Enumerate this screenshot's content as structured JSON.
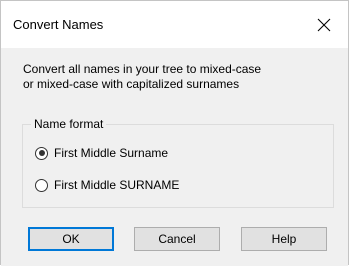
{
  "window": {
    "title": "Convert Names",
    "close_icon": "close-icon"
  },
  "description": {
    "line1": "Convert all names in your tree to mixed-case",
    "line2": "or mixed-case with capitalized surnames"
  },
  "name_format": {
    "legend": "Name format",
    "options": [
      {
        "label": "First Middle Surname",
        "selected": true
      },
      {
        "label": "First Middle SURNAME",
        "selected": false
      }
    ]
  },
  "buttons": {
    "ok": "OK",
    "cancel": "Cancel",
    "help": "Help"
  },
  "colors": {
    "default_button_border": "#0078d7",
    "button_face": "#e1e1e1",
    "dialog_background": "#f0f0f0"
  }
}
